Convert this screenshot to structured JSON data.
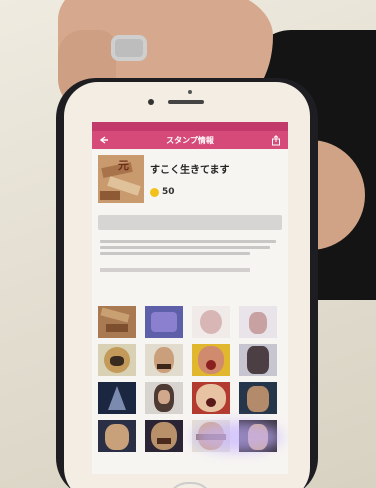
{
  "screen": {
    "nav_title": "スタンプ情報",
    "sticker_name": "すこく生きてます",
    "price": "50"
  },
  "colors": {
    "nav": "#d64a7a",
    "status": "#c23a6a",
    "coin": "#f2c21b"
  },
  "icons": {
    "back": "back-arrow-icon",
    "share": "share-icon",
    "coin": "coin-icon"
  }
}
